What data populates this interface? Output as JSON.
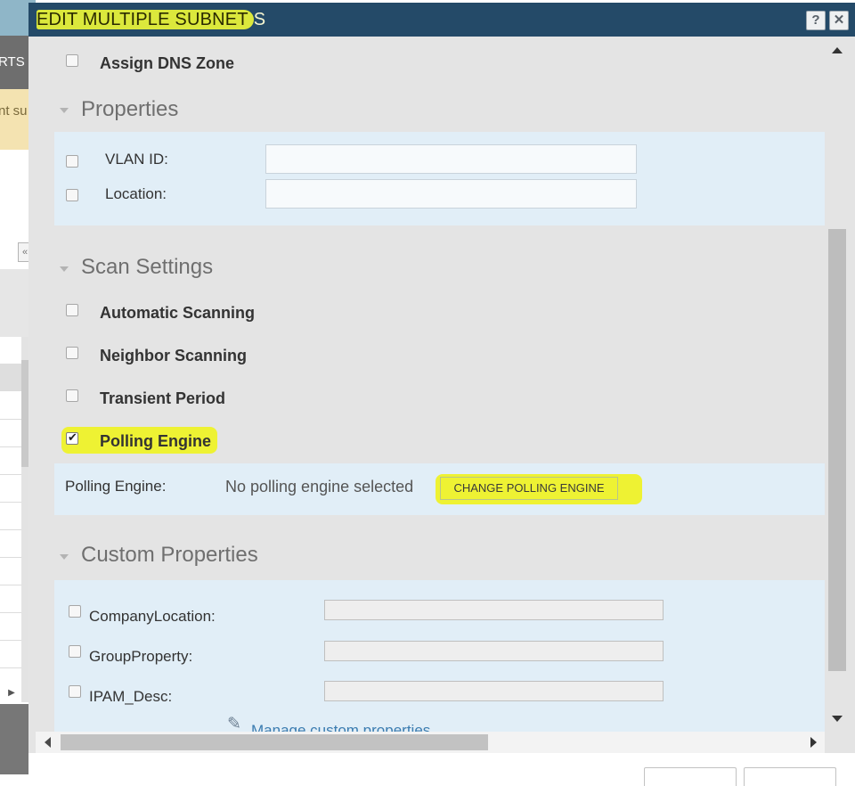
{
  "background": {
    "nav_fragment": "RTS &",
    "banner_fragment": "nt su"
  },
  "dialog": {
    "title_highlighted": "EDIT MULTIPLE SUBNET",
    "title_rest": "S",
    "help_icon": "?",
    "close_icon": "✕"
  },
  "dns": {
    "assign_dns_zone_label": "Assign DNS Zone",
    "checked": false
  },
  "properties": {
    "section_title": "Properties",
    "vlan_label": "VLAN ID:",
    "vlan_value": "",
    "location_label": "Location:",
    "location_value": ""
  },
  "scan_settings": {
    "section_title": "Scan Settings",
    "items": [
      {
        "label": "Automatic Scanning",
        "checked": false
      },
      {
        "label": "Neighbor Scanning",
        "checked": false
      },
      {
        "label": "Transient Period",
        "checked": false
      },
      {
        "label": "Polling Engine",
        "checked": true
      }
    ],
    "polling_engine_label": "Polling Engine:",
    "polling_engine_value": "No polling engine selected",
    "change_button": "CHANGE POLLING ENGINE",
    "highlight_color": "#eef233"
  },
  "custom_properties": {
    "section_title": "Custom Properties",
    "fields": [
      {
        "label": "CompanyLocation:",
        "value": ""
      },
      {
        "label": "GroupProperty:",
        "value": ""
      },
      {
        "label": "IPAM_Desc:",
        "value": ""
      }
    ],
    "manage_link": "Manage custom properties"
  },
  "colors": {
    "titlebar": "#244a68",
    "panel_light_blue": "#e1eef7",
    "dialog_grey": "#e4e4e4",
    "link": "#3b7cb0"
  },
  "icons": {
    "section_collapse": "triangle-down-icon",
    "pencil": "pencil-icon",
    "help": "question-icon",
    "close": "close-icon"
  }
}
